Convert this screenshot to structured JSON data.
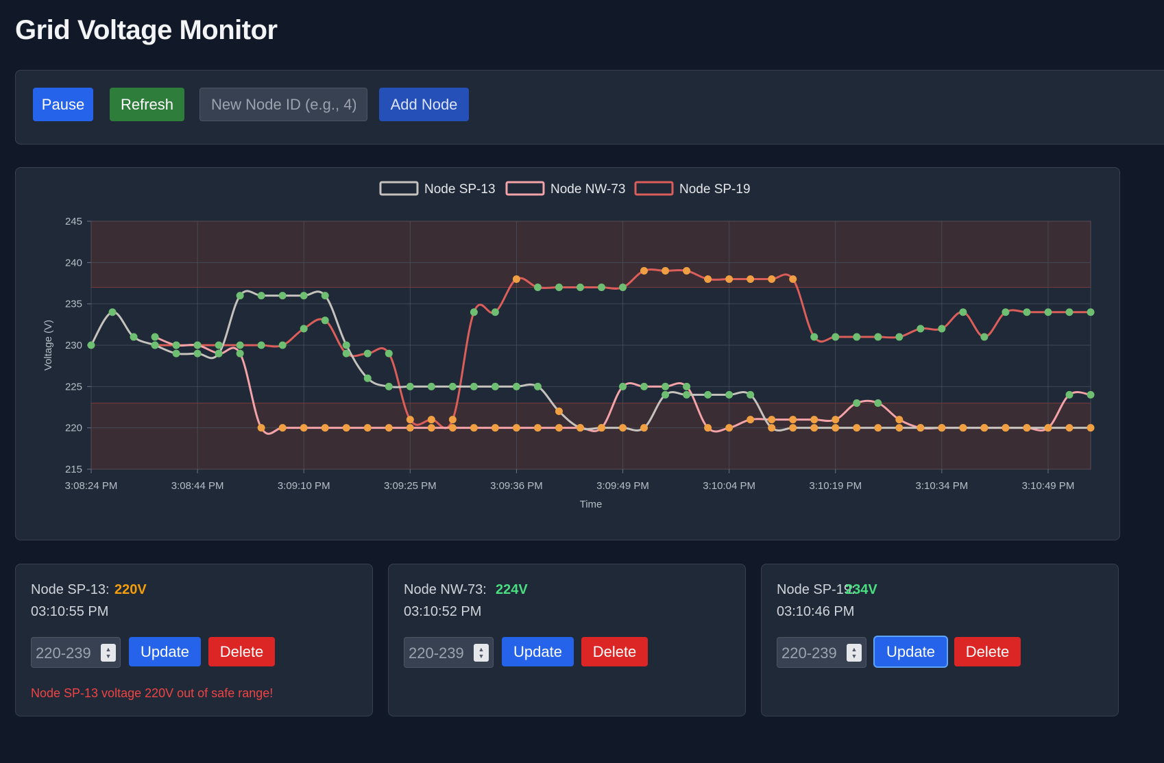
{
  "app": {
    "title": "Grid Voltage Monitor"
  },
  "controls": {
    "pause_label": "Pause",
    "refresh_label": "Refresh",
    "new_node_placeholder": "New Node ID (e.g., 4)",
    "add_label": "Add Node"
  },
  "colors": {
    "background": "#111827",
    "card": "#1f2937",
    "ok_point": "#6fbf73",
    "warn_point": "#f0a043",
    "out_of_range_band": "#3a2d33",
    "ok_value": "#4ade80",
    "warn_value": "#f59e0b",
    "danger_text": "#ef4444"
  },
  "chart_data": {
    "type": "line",
    "xlabel": "Time",
    "ylabel": "Voltage (V)",
    "ylim": [
      215,
      245
    ],
    "yticks": [
      215,
      220,
      225,
      230,
      235,
      240,
      245
    ],
    "xtick_labels": [
      "3:08:24 PM",
      "3:08:44 PM",
      "3:09:10 PM",
      "3:09:25 PM",
      "3:09:36 PM",
      "3:09:49 PM",
      "3:10:04 PM",
      "3:10:19 PM",
      "3:10:34 PM",
      "3:10:49 PM"
    ],
    "grid": true,
    "legend_position": "top-center",
    "safe_range": [
      223,
      237
    ],
    "unsafe_bands": [
      [
        215,
        223
      ],
      [
        237,
        245
      ]
    ],
    "samples_per_tick": 5,
    "series": [
      {
        "name": "Node SP-13",
        "color": "#c6c2bd",
        "values": [
          230,
          234,
          231,
          230,
          229,
          229,
          229,
          236,
          236,
          236,
          236,
          236,
          230,
          226,
          225,
          225,
          225,
          225,
          225,
          225,
          225,
          225,
          222,
          220,
          220,
          220,
          220,
          224,
          224,
          224,
          224,
          224,
          220,
          220,
          220,
          220,
          220,
          220,
          220,
          220,
          220,
          220,
          220,
          220,
          220,
          220,
          220,
          220
        ]
      },
      {
        "name": "Node NW-73",
        "color": "#f4a3a8",
        "values": [
          null,
          null,
          null,
          231,
          230,
          230,
          229,
          229,
          220,
          220,
          220,
          220,
          220,
          220,
          220,
          220,
          220,
          220,
          220,
          220,
          220,
          220,
          220,
          220,
          220,
          225,
          225,
          225,
          225,
          220,
          220,
          221,
          221,
          221,
          221,
          221,
          223,
          223,
          221,
          220,
          220,
          220,
          220,
          220,
          220,
          220,
          224,
          224
        ]
      },
      {
        "name": "Node SP-19",
        "color": "#dc5e5a",
        "values": [
          null,
          null,
          null,
          230,
          230,
          230,
          230,
          230,
          230,
          230,
          232,
          233,
          229,
          229,
          229,
          221,
          221,
          221,
          234,
          234,
          238,
          237,
          237,
          237,
          237,
          237,
          239,
          239,
          239,
          238,
          238,
          238,
          238,
          238,
          231,
          231,
          231,
          231,
          231,
          232,
          232,
          234,
          231,
          234,
          234,
          234,
          234,
          234
        ]
      }
    ]
  },
  "nodes": [
    {
      "label": "Node SP-13:",
      "value": "220V",
      "status": "warn",
      "time": "03:10:55 PM",
      "range_placeholder": "220-239",
      "update_label": "Update",
      "delete_label": "Delete",
      "warning": "Node SP-13 voltage 220V out of safe range!"
    },
    {
      "label": "Node NW-73:",
      "value": "224V",
      "status": "ok",
      "time": "03:10:52 PM",
      "range_placeholder": "220-239",
      "update_label": "Update",
      "delete_label": "Delete",
      "warning": ""
    },
    {
      "label": "Node SP-19:",
      "value": "234V",
      "status": "ok",
      "time": "03:10:46 PM",
      "range_placeholder": "220-239",
      "update_label": "Update",
      "delete_label": "Delete",
      "warning": ""
    }
  ]
}
